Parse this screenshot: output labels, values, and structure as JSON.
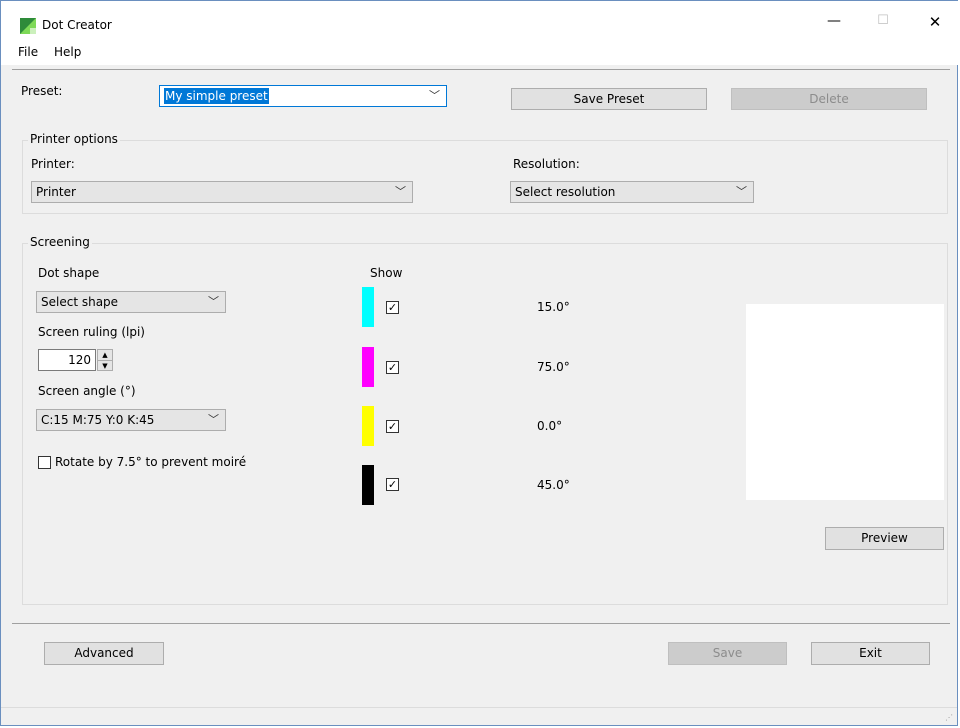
{
  "window": {
    "title": "Dot Creator",
    "controls": {
      "minimize": "—",
      "maximize": "☐",
      "close": "✕"
    }
  },
  "menu": {
    "items": [
      "File",
      "Help"
    ]
  },
  "preset": {
    "label": "Preset:",
    "value": "My simple preset",
    "save_label": "Save Preset",
    "delete_label": "Delete"
  },
  "printer_options": {
    "legend": "Printer options",
    "printer_label": "Printer:",
    "printer_value": "Printer",
    "resolution_label": "Resolution:",
    "resolution_value": "Select resolution"
  },
  "screening": {
    "legend": "Screening",
    "dot_shape_label": "Dot shape",
    "dot_shape_value": "Select shape",
    "ruling_label": "Screen ruling (lpi)",
    "ruling_value": "120",
    "angle_label": "Screen angle (°)",
    "angle_value": "C:15 M:75 Y:0 K:45",
    "rotate_label": "Rotate by 7.5° to prevent moiré",
    "rotate_checked": false,
    "show_label": "Show",
    "channels": [
      {
        "name": "cyan",
        "color": "#00ffff",
        "checked": true,
        "angle": "15.0°"
      },
      {
        "name": "magenta",
        "color": "#ff00ff",
        "checked": true,
        "angle": "75.0°"
      },
      {
        "name": "yellow",
        "color": "#ffff00",
        "checked": true,
        "angle": "0.0°"
      },
      {
        "name": "black",
        "color": "#000000",
        "checked": true,
        "angle": "45.0°"
      }
    ],
    "preview_label": "Preview"
  },
  "footer": {
    "advanced_label": "Advanced",
    "save_label": "Save",
    "exit_label": "Exit"
  }
}
